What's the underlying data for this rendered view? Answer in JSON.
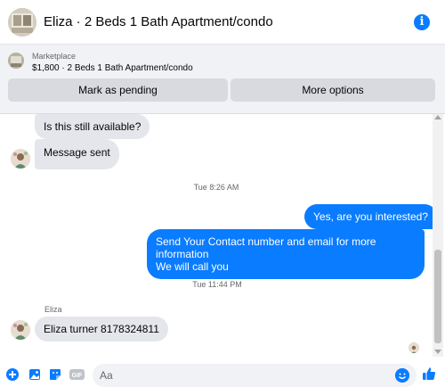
{
  "header": {
    "contact_name": "Eliza",
    "listing_title": "2 Beds 1 Bath Apartment/condo",
    "info_glyph": "i"
  },
  "marketplace": {
    "label": "Marketplace",
    "listing": "$1,800 · 2 Beds 1 Bath Apartment/condo",
    "buttons": {
      "mark_pending": "Mark as pending",
      "more_options": "More options"
    }
  },
  "messages": [
    {
      "direction": "incoming",
      "text": "Is this still available?"
    },
    {
      "direction": "incoming",
      "text": "Message sent"
    },
    {
      "type": "timestamp",
      "text": "Tue 8:26 AM"
    },
    {
      "direction": "outgoing",
      "text": "Yes, are you interested?"
    },
    {
      "direction": "outgoing",
      "lines": [
        "Send Your Contact number and email for more information",
        "We will call you"
      ]
    },
    {
      "type": "timestamp",
      "text": "Tue 11:44 PM"
    },
    {
      "type": "sender",
      "text": "Eliza"
    },
    {
      "direction": "incoming",
      "text": "Eliza turner 8178324811"
    }
  ],
  "composer": {
    "placeholder": "Aa",
    "icons": [
      "plus-icon",
      "photo-icon",
      "sticker-icon",
      "gif-icon",
      "emoji-icon",
      "thumbs-up-icon"
    ],
    "gif_label": "GIF"
  },
  "colors": {
    "accent": "#0a7cff",
    "incoming_bubble": "#e4e6eb",
    "outgoing_bubble": "#0a7cff",
    "marketplace_bg": "#f0f2f5",
    "button_bg": "#d8dadf"
  }
}
